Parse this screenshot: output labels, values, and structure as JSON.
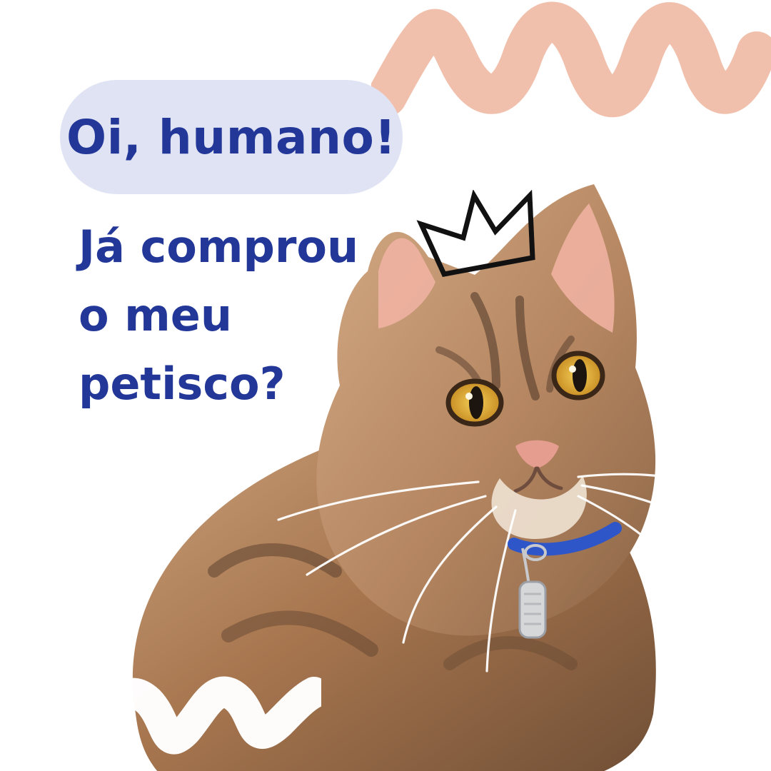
{
  "greeting": {
    "text": "Oi, humano!"
  },
  "question": {
    "lines": [
      "Já comprou",
      "o meu",
      "petisco?"
    ]
  },
  "decor": {
    "crown_icon": "crown-icon",
    "cat_image": "cat-illustration",
    "top_squiggle": "peach-brush-squiggle",
    "bottom_squiggle": "white-brush-squiggle"
  },
  "colors": {
    "text_primary": "#223797",
    "pill_background": "#dfe3f4",
    "peach_brush": "#f1c0ad",
    "white_brush": "#ffffff"
  }
}
